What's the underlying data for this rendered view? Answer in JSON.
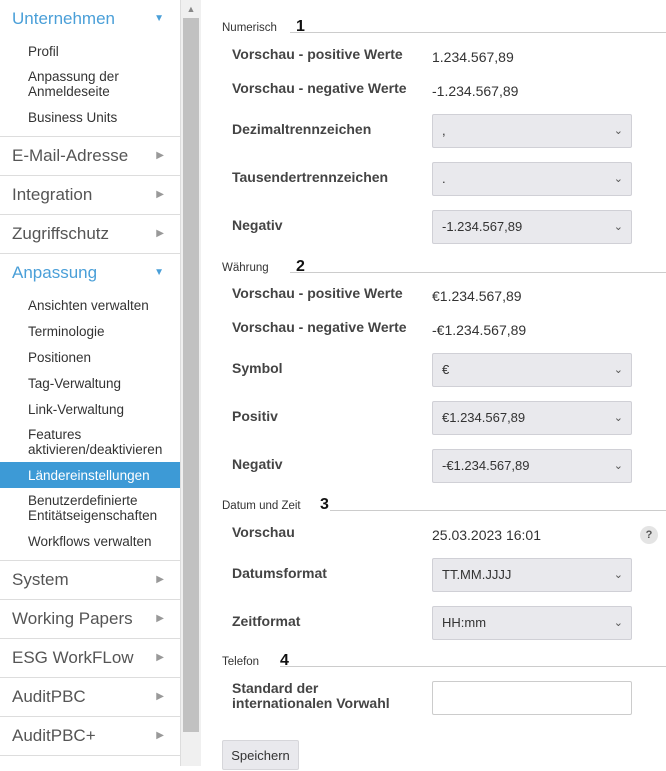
{
  "sidebar": {
    "groups": [
      {
        "label": "Unternehmen",
        "open": true,
        "items": [
          "Profil",
          "Anpassung der Anmeldeseite",
          "Business Units"
        ]
      },
      {
        "label": "E-Mail-Adresse",
        "open": false
      },
      {
        "label": "Integration",
        "open": false
      },
      {
        "label": "Zugriffschutz",
        "open": false
      },
      {
        "label": "Anpassung",
        "open": true,
        "items": [
          "Ansichten verwalten",
          "Terminologie",
          "Positionen",
          "Tag-Verwaltung",
          "Link-Verwaltung",
          "Features aktivieren/deaktivieren",
          "Ländereinstellungen",
          "Benutzerdefinierte Entitätseigenschaften",
          "Workflows verwalten"
        ],
        "active_item": "Ländereinstellungen"
      },
      {
        "label": "System",
        "open": false
      },
      {
        "label": "Working Papers",
        "open": false
      },
      {
        "label": "ESG WorkFLow",
        "open": false
      },
      {
        "label": "AuditPBC",
        "open": false
      },
      {
        "label": "AuditPBC+",
        "open": false
      }
    ],
    "arrow_open": "▼",
    "arrow_closed": "▶"
  },
  "sections": {
    "numeric": {
      "title": "Numerisch",
      "number": "1",
      "preview_pos_label": "Vorschau - positive Werte",
      "preview_pos_value": "1.234.567,89",
      "preview_neg_label": "Vorschau - negative Werte",
      "preview_neg_value": "-1.234.567,89",
      "decimal_label": "Dezimaltrennzeichen",
      "decimal_value": ",",
      "thousand_label": "Tausendertrennzeichen",
      "thousand_value": ".",
      "negative_label": "Negativ",
      "negative_value": "-1.234.567,89"
    },
    "currency": {
      "title": "Währung",
      "number": "2",
      "preview_pos_label": "Vorschau - positive Werte",
      "preview_pos_value": "€1.234.567,89",
      "preview_neg_label": "Vorschau - negative Werte",
      "preview_neg_value": "-€1.234.567,89",
      "symbol_label": "Symbol",
      "symbol_value": "€",
      "positive_label": "Positiv",
      "positive_value": "€1.234.567,89",
      "negative_label": "Negativ",
      "negative_value": "-€1.234.567,89"
    },
    "datetime": {
      "title": "Datum und Zeit",
      "number": "3",
      "preview_label": "Vorschau",
      "preview_value": "25.03.2023 16:01",
      "help": "?",
      "date_format_label": "Datumsformat",
      "date_format_value": "TT.MM.JJJJ",
      "time_format_label": "Zeitformat",
      "time_format_value": "HH:mm"
    },
    "phone": {
      "title": "Telefon",
      "number": "4",
      "intl_label": "Standard der internationalen Vorwahl",
      "intl_value": ""
    }
  },
  "save_label": "Speichern",
  "colors": {
    "accent": "#4a9fd8",
    "active_bg": "#3d9ad6"
  }
}
